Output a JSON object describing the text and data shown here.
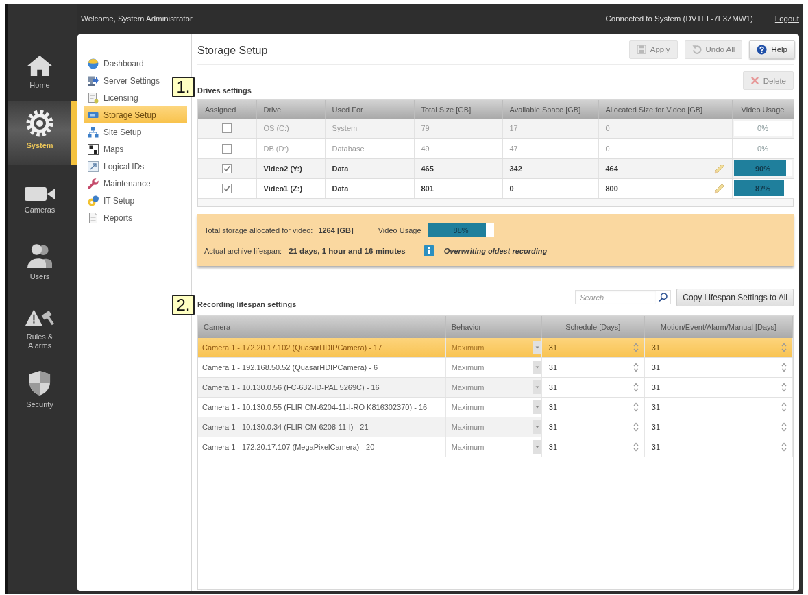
{
  "top_bar": {
    "welcome": "Welcome, System Administrator",
    "connection": "Connected to System (DVTEL-7F3ZMW1)",
    "logout": "Logout"
  },
  "nav_rail": [
    {
      "kind": "home",
      "label": "Home",
      "selected": false
    },
    {
      "kind": "system",
      "label": "System",
      "selected": true
    },
    {
      "kind": "cameras",
      "label": "Cameras",
      "selected": false
    },
    {
      "kind": "users",
      "label": "Users",
      "selected": false
    },
    {
      "kind": "rules",
      "label": "Rules & Alarms",
      "selected": false
    },
    {
      "kind": "security",
      "label": "Security",
      "selected": false
    }
  ],
  "sub_nav": [
    {
      "kind": "dashboard",
      "label": "Dashboard",
      "selected": false
    },
    {
      "kind": "server",
      "label": "Server Settings",
      "selected": false
    },
    {
      "kind": "licensing",
      "label": "Licensing",
      "selected": false
    },
    {
      "kind": "storage",
      "label": "Storage Setup",
      "selected": true
    },
    {
      "kind": "site",
      "label": "Site Setup",
      "selected": false
    },
    {
      "kind": "maps",
      "label": "Maps",
      "selected": false
    },
    {
      "kind": "logical",
      "label": "Logical IDs",
      "selected": false
    },
    {
      "kind": "maintenance",
      "label": "Maintenance",
      "selected": false
    },
    {
      "kind": "it",
      "label": "IT Setup",
      "selected": false
    },
    {
      "kind": "reports",
      "label": "Reports",
      "selected": false
    }
  ],
  "page": {
    "title": "Storage Setup",
    "buttons": [
      {
        "kind": "save",
        "label": "Apply",
        "disabled": true
      },
      {
        "kind": "undo",
        "label": "Undo All",
        "disabled": true
      },
      {
        "kind": "help",
        "label": "Help",
        "disabled": false
      }
    ]
  },
  "drives": {
    "marker": "1.",
    "title": "Drives settings",
    "delete_button": {
      "label": "Delete",
      "disabled": true
    },
    "columns": [
      "Assigned",
      "Drive",
      "Used For",
      "Total Size [GB]",
      "Available Space [GB]",
      "Allocated Size for Video [GB]",
      "Video Usage"
    ],
    "rows": [
      {
        "assigned": false,
        "drive": "OS (C:)",
        "used_for": "System",
        "total_size": "79",
        "available_space": "17",
        "allocated_size": "0",
        "usage": "0%",
        "level": 0
      },
      {
        "assigned": false,
        "drive": "DB (D:)",
        "used_for": "Database",
        "total_size": "49",
        "available_space": "47",
        "allocated_size": "0",
        "usage": "0%",
        "level": 0
      },
      {
        "assigned": true,
        "drive": "Video2 (Y:)",
        "used_for": "Data",
        "total_size": "465",
        "available_space": "342",
        "allocated_size": "464",
        "usage": "90%",
        "level": 0.9
      },
      {
        "assigned": true,
        "drive": "Video1 (Z:)",
        "used_for": "Data",
        "total_size": "801",
        "available_space": "0",
        "allocated_size": "800",
        "usage": "87%",
        "level": 0.87
      }
    ]
  },
  "summary": {
    "total_label": "Total storage allocated for video:",
    "total_value": "1264 [GB]",
    "usage_label": "Video Usage",
    "usage": "88%",
    "level": 0.88,
    "lifespan_label": "Actual archive lifespan:",
    "lifespan_value": "21 days, 1 hour and 16 minutes",
    "status": "Overwriting oldest recording"
  },
  "recording": {
    "marker": "2.",
    "title": "Recording lifespan settings",
    "search": {
      "placeholder": "Search"
    },
    "copy_button": "Copy Lifespan Settings to All",
    "columns": [
      "Camera",
      "Behavior",
      "Schedule [Days]",
      "Motion/Event/Alarm/Manual [Days]"
    ],
    "rows": [
      {
        "camera": "Camera 1 - 172.20.17.102 (QuasarHDIPCamera) - 17",
        "behavior": "Maximum",
        "schedule_days": "31",
        "motion_days": "31",
        "selected": true
      },
      {
        "camera": "Camera 1 - 192.168.50.52 (QuasarHDIPCamera) - 6",
        "behavior": "Maximum",
        "schedule_days": "31",
        "motion_days": "31",
        "selected": false
      },
      {
        "camera": "Camera 1 - 10.130.0.56 (FC-632-ID-PAL 5269C) - 16",
        "behavior": "Maximum",
        "schedule_days": "31",
        "motion_days": "31",
        "selected": false
      },
      {
        "camera": "Camera 1 - 10.130.0.55 (FLIR CM-6204-11-I-RO K816302370) - 16",
        "behavior": "Maximum",
        "schedule_days": "31",
        "motion_days": "31",
        "selected": false
      },
      {
        "camera": "Camera 1 - 10.130.0.34 (FLIR CM-6208-11-I) - 21",
        "behavior": "Maximum",
        "schedule_days": "31",
        "motion_days": "31",
        "selected": false
      },
      {
        "camera": "Camera 1 - 172.20.17.107 (MegaPixelCamera) - 20",
        "behavior": "Maximum",
        "schedule_days": "31",
        "motion_days": "31",
        "selected": false
      }
    ]
  }
}
